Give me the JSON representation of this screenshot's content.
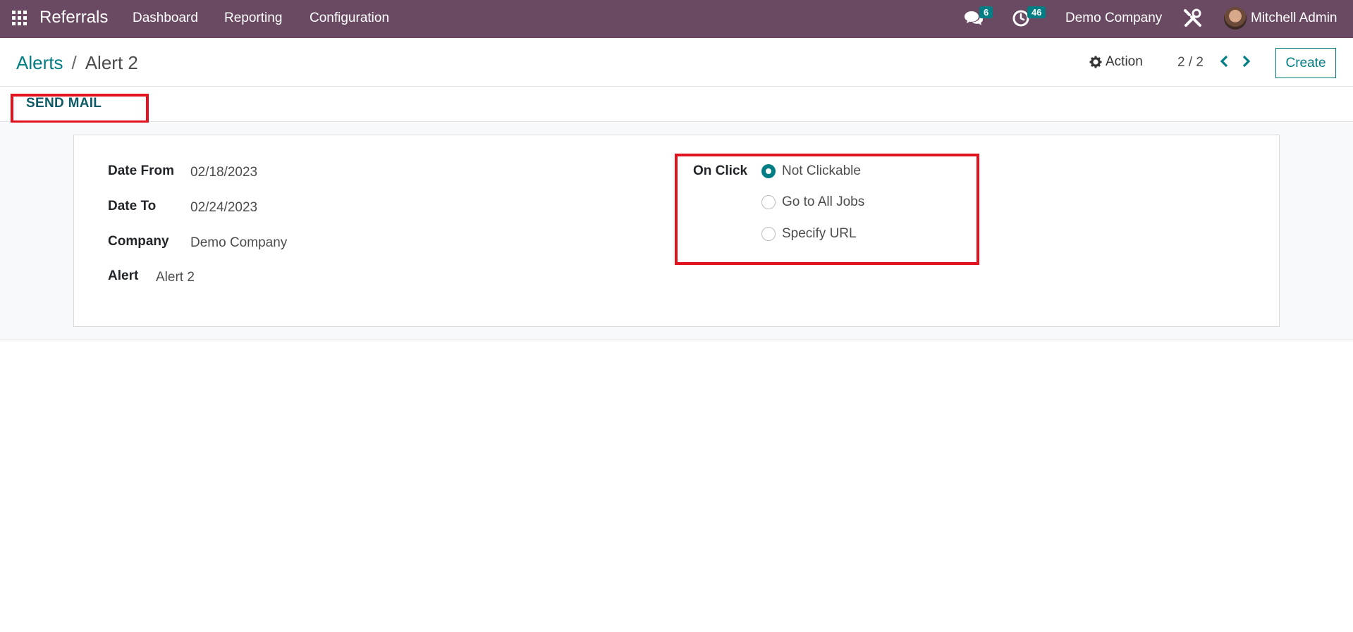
{
  "navbar": {
    "app_name": "Referrals",
    "menu": [
      "Dashboard",
      "Reporting",
      "Configuration"
    ],
    "messages_count": "6",
    "activities_count": "46",
    "company": "Demo Company",
    "user": "Mitchell Admin",
    "accent_color": "#6a4a62"
  },
  "control_panel": {
    "breadcrumb_parent": "Alerts",
    "breadcrumb_sep": "/",
    "breadcrumb_current": "Alert 2",
    "action_label": "Action",
    "pager": "2 / 2",
    "create_label": "Create"
  },
  "statusbar": {
    "send_mail_label": "SEND MAIL"
  },
  "form": {
    "date_from_label": "Date From",
    "date_from_value": "02/18/2023",
    "date_to_label": "Date To",
    "date_to_value": "02/24/2023",
    "company_label": "Company",
    "company_value": "Demo Company",
    "alert_label": "Alert",
    "alert_value": "Alert 2",
    "on_click_label": "On Click",
    "on_click_options": [
      "Not Clickable",
      "Go to All Jobs",
      "Specify URL"
    ],
    "on_click_selected": "Not Clickable"
  },
  "colors": {
    "primary": "#017e84",
    "highlight": "#e2131f"
  }
}
